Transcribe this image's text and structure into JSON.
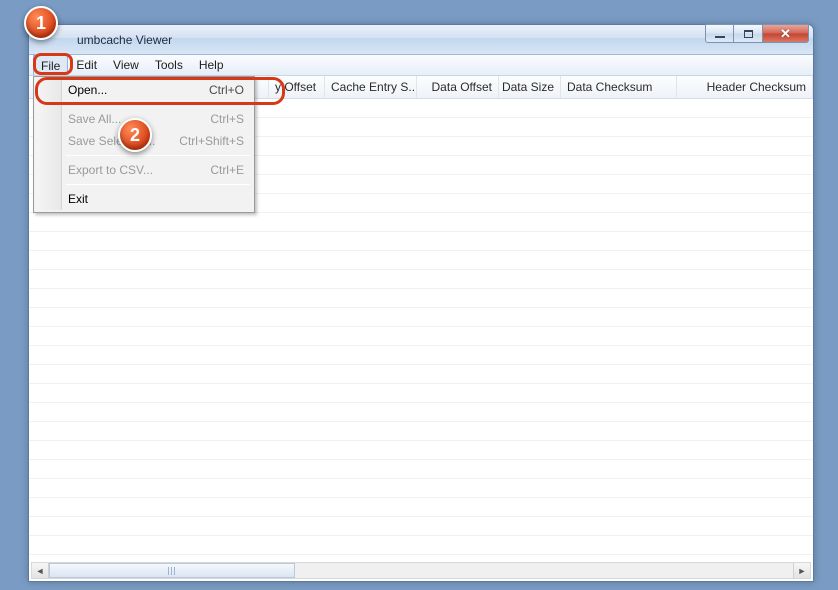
{
  "window": {
    "title": "umbcache Viewer"
  },
  "menubar": {
    "items": [
      {
        "label": "File",
        "open": true
      },
      {
        "label": "Edit",
        "open": false
      },
      {
        "label": "View",
        "open": false
      },
      {
        "label": "Tools",
        "open": false
      },
      {
        "label": "Help",
        "open": false
      }
    ]
  },
  "file_menu": {
    "open": {
      "label": "Open...",
      "shortcut": "Ctrl+O",
      "enabled": true
    },
    "save_all": {
      "label": "Save All...",
      "shortcut": "Ctrl+S",
      "enabled": false
    },
    "save_selected": {
      "label": "Save Selected...",
      "shortcut": "Ctrl+Shift+S",
      "enabled": false
    },
    "export_csv": {
      "label": "Export to CSV...",
      "shortcut": "Ctrl+E",
      "enabled": false
    },
    "exit": {
      "label": "Exit",
      "shortcut": "",
      "enabled": true
    }
  },
  "columns": [
    {
      "label": "",
      "width": 32
    },
    {
      "label": "y Offset",
      "width": 56
    },
    {
      "label": "Cache Entry S...",
      "width": 92
    },
    {
      "label": "Data Offset",
      "width": 82
    },
    {
      "label": "Data Size",
      "width": 62
    },
    {
      "label": "Data Checksum",
      "width": 116
    },
    {
      "label": "Header Checksum",
      "width": 112
    }
  ],
  "annotations": {
    "one": "1",
    "two": "2"
  }
}
